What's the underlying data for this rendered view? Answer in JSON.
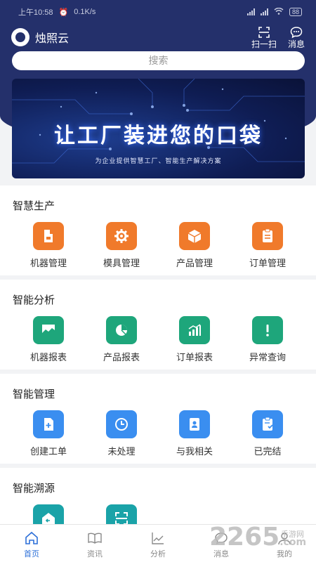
{
  "status": {
    "time": "上午10:58",
    "speed": "0.1K/s",
    "battery": "88"
  },
  "header": {
    "app_name": "烛照云",
    "scan_label": "扫一扫",
    "message_label": "消息"
  },
  "search": {
    "placeholder": "搜索"
  },
  "banner": {
    "title": "让工厂装进您的口袋",
    "subtitle": "为企业提供智慧工厂、智能生产解决方案"
  },
  "sections": [
    {
      "title": "智慧生产",
      "items": [
        {
          "label": "机器管理",
          "icon": "machine-icon",
          "color": "#f07a2b"
        },
        {
          "label": "模具管理",
          "icon": "gear-icon",
          "color": "#f07a2b"
        },
        {
          "label": "产品管理",
          "icon": "box-icon",
          "color": "#f07a2b"
        },
        {
          "label": "订单管理",
          "icon": "list-icon",
          "color": "#f07a2b"
        }
      ]
    },
    {
      "title": "智能分析",
      "items": [
        {
          "label": "机器报表",
          "icon": "area-chart-icon",
          "color": "#1ea67b"
        },
        {
          "label": "产品报表",
          "icon": "pie-chart-icon",
          "color": "#1ea67b"
        },
        {
          "label": "订单报表",
          "icon": "bar-chart-icon",
          "color": "#1ea67b"
        },
        {
          "label": "异常查询",
          "icon": "exclamation-icon",
          "color": "#1ea67b"
        }
      ]
    },
    {
      "title": "智能管理",
      "items": [
        {
          "label": "创建工单",
          "icon": "add-document-icon",
          "color": "#3a8ef0"
        },
        {
          "label": "未处理",
          "icon": "clock-icon",
          "color": "#3a8ef0"
        },
        {
          "label": "与我相关",
          "icon": "badge-icon",
          "color": "#3a8ef0"
        },
        {
          "label": "已完结",
          "icon": "clipboard-check-icon",
          "color": "#3a8ef0"
        }
      ]
    },
    {
      "title": "智能溯源",
      "items": [
        {
          "label": "",
          "icon": "home-back-icon",
          "color": "#1aa3a8"
        },
        {
          "label": "",
          "icon": "scan-icon",
          "color": "#1aa3a8"
        }
      ]
    }
  ],
  "tabs": [
    {
      "label": "首页",
      "icon": "home-icon",
      "active": true
    },
    {
      "label": "资讯",
      "icon": "book-icon",
      "active": false
    },
    {
      "label": "分析",
      "icon": "line-chart-icon",
      "active": false
    },
    {
      "label": "消息",
      "icon": "message-icon",
      "active": false
    },
    {
      "label": "我的",
      "icon": "user-icon",
      "active": false
    }
  ],
  "watermark": {
    "text": "2265",
    "suffix": ".com",
    "sub": "手游网"
  }
}
